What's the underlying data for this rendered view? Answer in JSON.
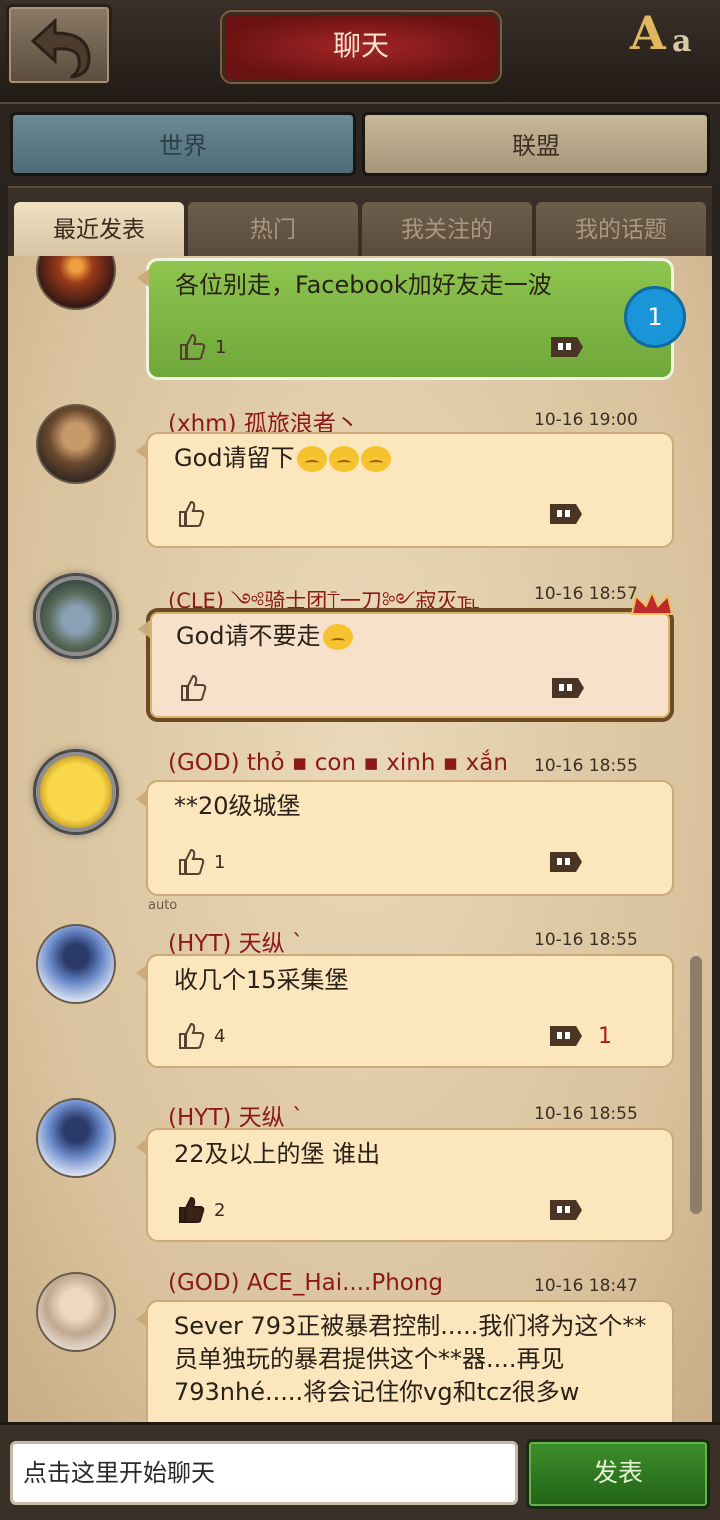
{
  "header": {
    "title": "聊天",
    "font_icon_big": "A",
    "font_icon_small": "a"
  },
  "channels": {
    "world": "世界",
    "alliance": "联盟"
  },
  "subtabs": [
    {
      "label": "最近发表",
      "active": true
    },
    {
      "label": "热门",
      "active": false
    },
    {
      "label": "我关注的",
      "active": false
    },
    {
      "label": "我的话题",
      "active": false
    }
  ],
  "messages": [
    {
      "text": "各位别走，Facebook加好友走一波",
      "likes": "1",
      "unread": "1"
    },
    {
      "sender": "(xhm) 孤旅浪者丶",
      "time": "10-16 19:00",
      "text": "God请留下",
      "likes": ""
    },
    {
      "sender": "(CLE) ༺骑士团⍑一刀༻寂灭℡",
      "time": "10-16 18:57",
      "text": "God请不要走",
      "likes": ""
    },
    {
      "sender": "(GOD) thỏ ▪ con ▪ xinh ▪ xắn",
      "time": "10-16 18:55",
      "text": "**20级城堡",
      "likes": "1"
    },
    {
      "sender": "(HYT) 天纵 `",
      "time": "10-16 18:55",
      "text": "收几个15采集堡",
      "likes": "4",
      "replies": "1"
    },
    {
      "sender": "(HYT) 天纵 `",
      "time": "10-16 18:55",
      "text": "22及以上的堡 谁出",
      "likes": "2"
    },
    {
      "sender": "(GOD) ACE_Hai....Phong",
      "time": "10-16 18:47",
      "text": "Sever 793正被暴君控制.....我们将为这个**员单独玩的暴君提供这个**器....再见793nhé.....将会记住你vg和tcz很多w"
    }
  ],
  "auto_label": "auto",
  "input": {
    "placeholder": "点击这里开始聊天"
  },
  "send_button": "发表",
  "colors": {
    "sender": "#8c1818",
    "bubble": "#fbe6bd",
    "send": "#2e7a20",
    "badge": "#1a95d8"
  }
}
